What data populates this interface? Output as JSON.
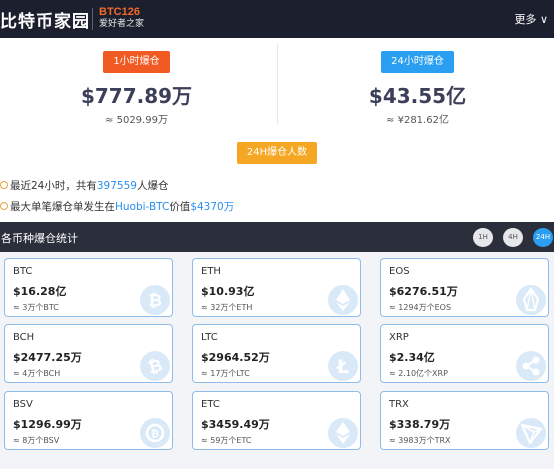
{
  "header": {
    "brand": "比特币家园",
    "code": "BTC126",
    "tagline": "爱好者之家",
    "more": "更多"
  },
  "summary": {
    "left": {
      "badge": "1小时爆仓",
      "amount": "$777.89万",
      "sub": "≈ 5029.99万"
    },
    "right": {
      "badge": "24小时爆仓",
      "amount": "$43.55亿",
      "sub": "≈ ¥281.62亿"
    },
    "center_badge": "24H爆仓人数",
    "line1": {
      "prefix": "最近24小时，共有",
      "count": "397559",
      "suffix": "人爆仓"
    },
    "line2": {
      "prefix": "最大单笔爆仓单发生在",
      "exchange": "Huobi-BTC",
      "mid": "价值",
      "value": "$4370万"
    }
  },
  "section": {
    "title": "各币种爆仓统计",
    "tabs": [
      "1H",
      "4H",
      "24H"
    ],
    "active_tab": "24H"
  },
  "colors": {
    "accent": "#2a9ef0",
    "orange": "#f25a24",
    "yellow": "#f5a623",
    "dark": "#1b1f2e"
  },
  "coins": [
    {
      "symbol": "BTC",
      "amount": "$16.28亿",
      "count": "≈ 3万个BTC",
      "icon": "bitcoin-icon"
    },
    {
      "symbol": "ETH",
      "amount": "$10.93亿",
      "count": "≈ 32万个ETH",
      "icon": "ethereum-icon"
    },
    {
      "symbol": "EOS",
      "amount": "$6276.51万",
      "count": "≈ 1294万个EOS",
      "icon": "eos-icon"
    },
    {
      "symbol": "BCH",
      "amount": "$2477.25万",
      "count": "≈ 4万个BCH",
      "icon": "bitcoin-cash-icon"
    },
    {
      "symbol": "LTC",
      "amount": "$2964.52万",
      "count": "≈ 17万个LTC",
      "icon": "litecoin-icon"
    },
    {
      "symbol": "XRP",
      "amount": "$2.34亿",
      "count": "≈ 2.10亿个XRP",
      "icon": "ripple-icon"
    },
    {
      "symbol": "BSV",
      "amount": "$1296.99万",
      "count": "≈ 8万个BSV",
      "icon": "bitcoin-sv-icon"
    },
    {
      "symbol": "ETC",
      "amount": "$3459.49万",
      "count": "≈ 59万个ETC",
      "icon": "ethereum-classic-icon"
    },
    {
      "symbol": "TRX",
      "amount": "$338.79万",
      "count": "≈ 3983万个TRX",
      "icon": "tron-icon"
    }
  ]
}
